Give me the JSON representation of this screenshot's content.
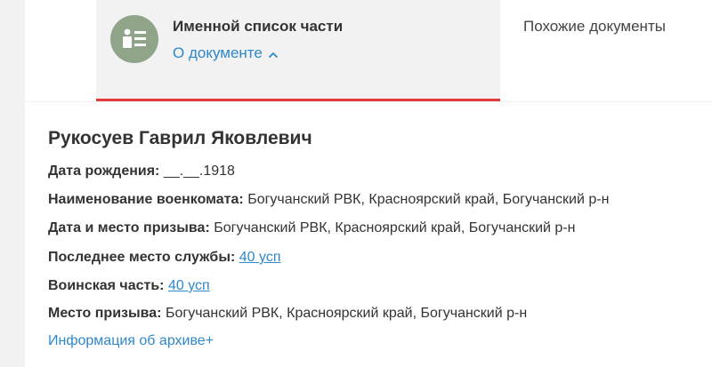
{
  "header": {
    "document_title": "Именной список части",
    "about_link": "О документе",
    "similar_tab": "Похожие документы",
    "accent_color": "#e2393d",
    "link_color": "#2e88c9",
    "icon": "document-list-icon"
  },
  "record": {
    "name": "Рукосуев Гаврил Яковлевич",
    "fields": [
      {
        "label": "Дата рождения:",
        "value": "__.__.1918"
      },
      {
        "label": "Наименование военкомата:",
        "value": "Богучанский РВК, Красноярский край, Богучанский р-н"
      },
      {
        "label": "Дата и место призыва:",
        "value": "Богучанский РВК, Красноярский край, Богучанский р-н"
      },
      {
        "label": "Последнее место службы:",
        "value": "40 усп"
      },
      {
        "label": "Воинская часть:",
        "value": "40 усп"
      },
      {
        "label": "Место призыва:",
        "value": "Богучанский РВК, Красноярский край, Богучанский р-н"
      }
    ],
    "archive_link": "Информация об архиве+"
  }
}
